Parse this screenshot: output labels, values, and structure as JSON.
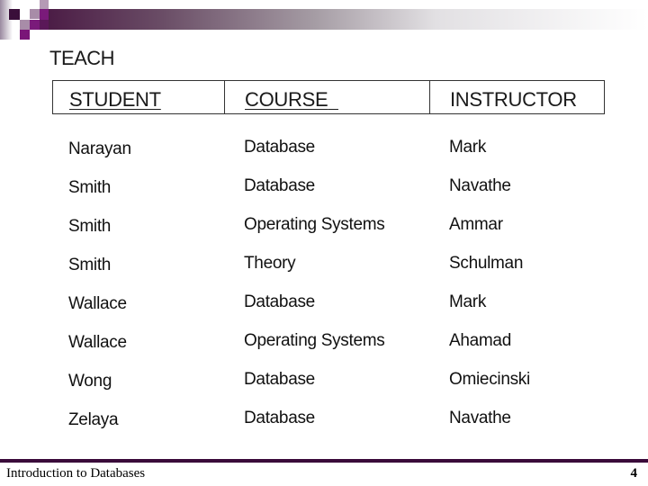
{
  "slide": {
    "title": "TEACH",
    "page_number": "4",
    "footer_text": "Introduction to Databases"
  },
  "colors": {
    "accent": "#3a0a3a",
    "banner_start": "#4a1a44",
    "square_purple": "#7a1a7a"
  },
  "table": {
    "columns": [
      {
        "label": "STUDENT",
        "underlined": true
      },
      {
        "label": "COURSE",
        "underlined": true
      },
      {
        "label": "INSTRUCTOR",
        "underlined": false
      }
    ],
    "rows": [
      [
        "Narayan",
        "Database",
        "Mark"
      ],
      [
        "Smith",
        "Database",
        "Navathe"
      ],
      [
        "Smith",
        "Operating Systems",
        "Ammar"
      ],
      [
        "Smith",
        "Theory",
        "Schulman"
      ],
      [
        "Wallace",
        "Database",
        "Mark"
      ],
      [
        "Wallace",
        "Operating Systems",
        "Ahamad"
      ],
      [
        "Wong",
        "Database",
        "Omiecinski"
      ],
      [
        "Zelaya",
        "Database",
        "Navathe"
      ]
    ]
  }
}
